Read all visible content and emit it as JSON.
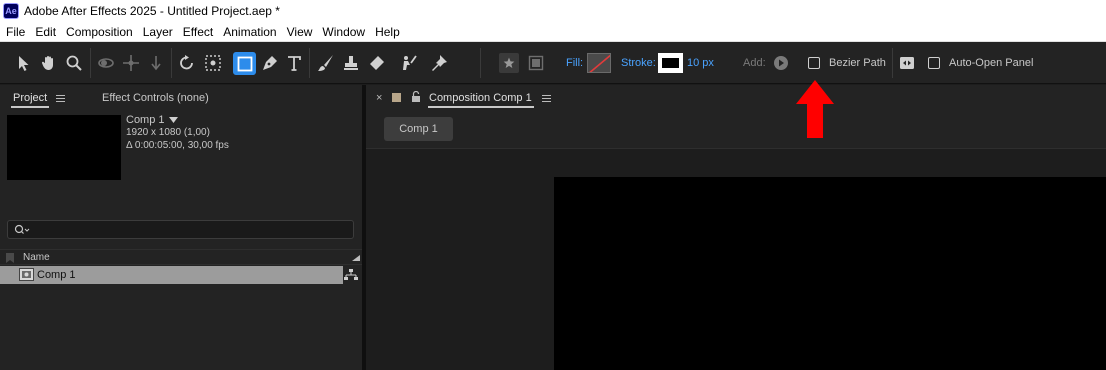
{
  "window": {
    "title": "Adobe After Effects 2025 - Untitled Project.aep *",
    "logo_text": "Ae"
  },
  "menu": [
    "File",
    "Edit",
    "Composition",
    "Layer",
    "Effect",
    "Animation",
    "View",
    "Window",
    "Help"
  ],
  "toolbar": {
    "tools": [
      "selection-tool",
      "hand-tool",
      "zoom-tool",
      "orbit-camera-tool",
      "pan-camera-tool",
      "dolly-camera-tool",
      "rotation-tool",
      "pan-behind-tool",
      "rectangle-tool",
      "pen-tool",
      "type-tool",
      "brush-tool",
      "clone-stamp-tool",
      "eraser-tool",
      "roto-brush-tool",
      "puppet-pin-tool"
    ],
    "active_tool": "rectangle-tool",
    "fill_label": "Fill:",
    "stroke_label": "Stroke:",
    "stroke_width": "10 px",
    "add_label": "Add:",
    "bezier_path_label": "Bezier Path",
    "auto_open_panel_label": "Auto-Open Panel",
    "bezier_path_checked": false,
    "auto_open_panel_checked": false
  },
  "project_panel": {
    "tab_label": "Project",
    "effect_controls_label": "Effect Controls (none)",
    "selected_item": {
      "name": "Comp 1",
      "resolution": "1920 x 1080 (1,00)",
      "duration": "Δ 0:00:05:00, 30,00 fps"
    },
    "search_placeholder": "",
    "columns": [
      "Name"
    ],
    "items": [
      {
        "name": "Comp 1",
        "selected": true
      }
    ]
  },
  "composition_panel": {
    "tab_label": "Composition Comp 1",
    "comp_button_label": "Comp 1"
  },
  "colors": {
    "accent_blue": "#2d8ceb",
    "label_blue": "#4aa3ff",
    "annotation_red": "#ff0000"
  },
  "annotation": {
    "type": "arrow-up",
    "target": "bezier-path-checkbox"
  }
}
